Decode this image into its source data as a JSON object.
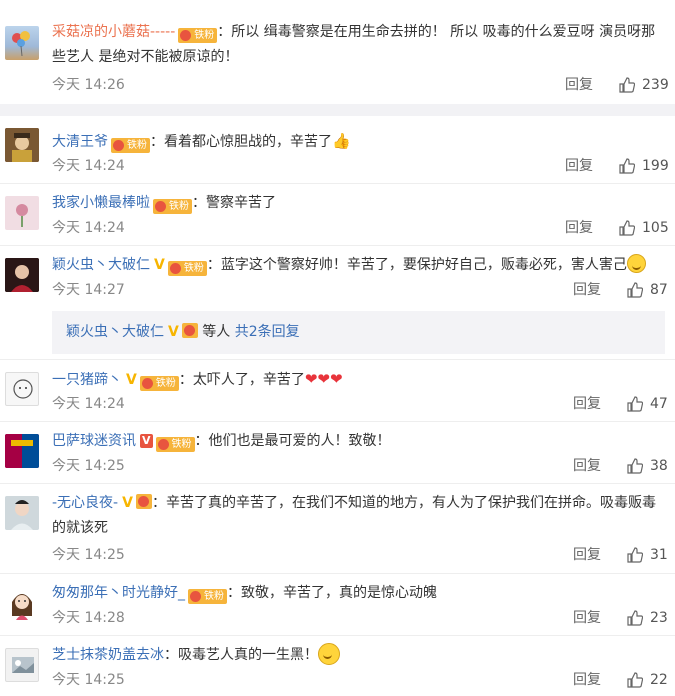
{
  "comments": [
    {
      "user": "采菇凉的小蘑菇-----",
      "badge": "铁粉",
      "content": "：所以 缉毒警察是在用生命去拼的！ 所以 吸毒的什么爱豆呀 演员呀那些艺人 是绝对不能被原谅的！",
      "time": "今天 14:26",
      "reply": "回复",
      "likes": "239"
    },
    {
      "user": "大清王爷",
      "badge": "铁粉",
      "content": "：看着都心惊胆战的，辛苦了",
      "time": "今天 14:24",
      "reply": "回复",
      "likes": "199"
    },
    {
      "user": "我家小懒最棒啦",
      "badge": "铁粉",
      "content": "：警察辛苦了",
      "time": "今天 14:24",
      "reply": "回复",
      "likes": "105"
    },
    {
      "user": "颖火虫丶大破仁",
      "badge": "铁粉",
      "content": "：蓝字这个警察好帅！辛苦了，要保护好自己，贩毒必死，害人害己",
      "time": "今天 14:27",
      "reply": "回复",
      "likes": "87",
      "sub_replies": {
        "user": "颖火虫丶大破仁",
        "mid": "等人",
        "link": "共2条回复"
      }
    },
    {
      "user": "一只猪蹄丶",
      "badge": "铁粉",
      "content": "：太吓人了，辛苦了",
      "time": "今天 14:24",
      "reply": "回复",
      "likes": "47"
    },
    {
      "user": "巴萨球迷资讯",
      "badge": "铁粉",
      "content": "：他们也是最可爱的人！致敬！",
      "time": "今天 14:25",
      "reply": "回复",
      "likes": "38"
    },
    {
      "user": "-无心良夜-",
      "content": "：辛苦了真的辛苦了，在我们不知道的地方，有人为了保护我们在拼命。吸毒贩毒的就该死",
      "time": "今天 14:25",
      "reply": "回复",
      "likes": "31"
    },
    {
      "user": "匆匆那年丶时光静好_",
      "badge": "铁粉",
      "content": "：致敬，辛苦了，真的是惊心动魄",
      "time": "今天 14:28",
      "reply": "回复",
      "likes": "23"
    },
    {
      "user": "芝士抹茶奶盖去冰",
      "content": "：吸毒艺人真的一生黑！",
      "time": "今天 14:25",
      "reply": "回复",
      "likes": "22"
    }
  ],
  "colors": {
    "username_orange": "#eb7350",
    "username_blue": "#3b6fb6",
    "badge_bg": "#f6b43b",
    "meta_gray": "#888888"
  }
}
